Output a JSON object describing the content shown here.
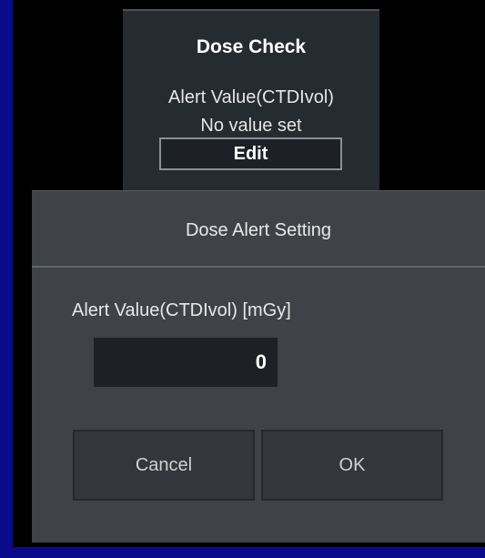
{
  "dose_check": {
    "title": "Dose Check",
    "alert_label": "Alert Value(CTDIvol)",
    "status": "No value set",
    "edit_label": "Edit"
  },
  "dialog": {
    "title": "Dose Alert Setting",
    "field_label": "Alert Value(CTDIvol) [mGy]",
    "field_value": "0",
    "cancel_label": "Cancel",
    "ok_label": "OK"
  },
  "colors": {
    "background": "#0a0a8c",
    "panel": "#262b30",
    "dialog": "#3f4348",
    "input": "#1d2024"
  }
}
